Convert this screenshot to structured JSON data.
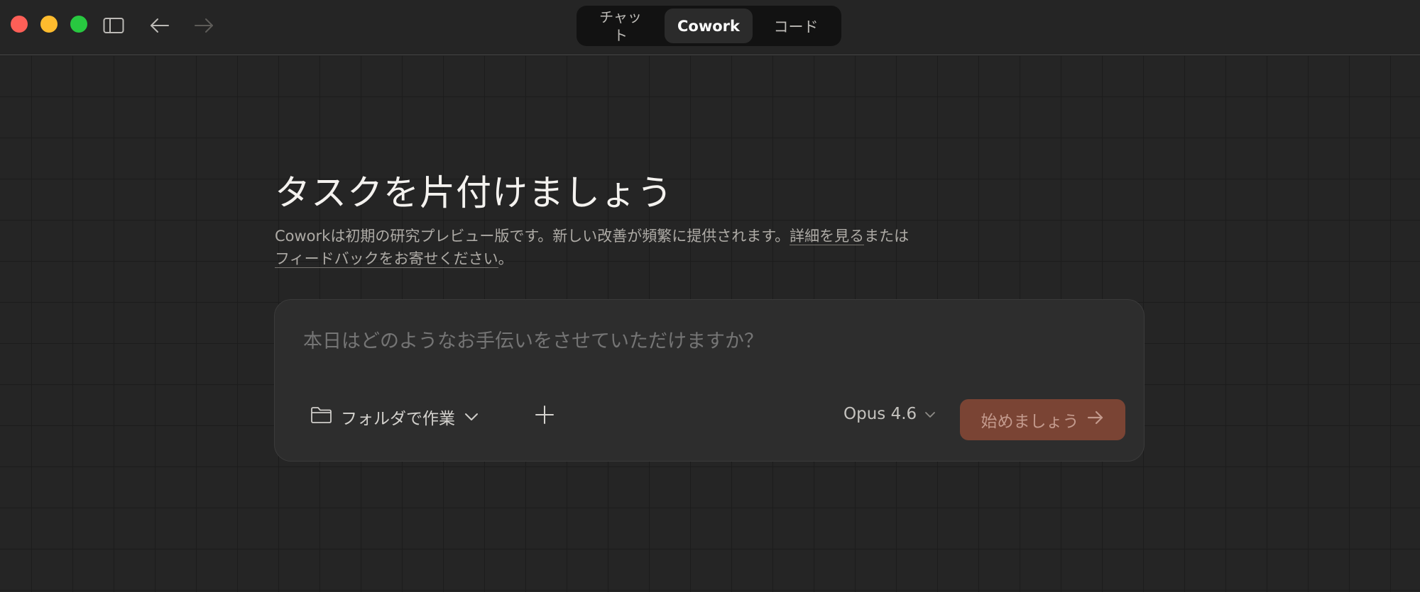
{
  "titlebar": {
    "modes": [
      {
        "label": "チャット",
        "selected": false
      },
      {
        "label": "Cowork",
        "selected": true
      },
      {
        "label": "コード",
        "selected": false
      }
    ]
  },
  "main": {
    "headline": "タスクを片付けましょう",
    "subtitle_prefix": "Coworkは初期の研究プレビュー版です。新しい改善が頻繁に提供されます。",
    "learn_more_link": "詳細を見る",
    "subtitle_middle": "または",
    "feedback_link": "フィードバックをお寄せください",
    "subtitle_suffix": "。"
  },
  "composer": {
    "placeholder": "本日はどのようなお手伝いをさせていただけますか？",
    "folder_label": "フォルダで作業",
    "model": "Opus 4.6",
    "start_label": "始めましょう"
  },
  "icons": {
    "sidebar": "sidebar-toggle-icon",
    "back": "arrow-left-icon",
    "forward": "arrow-right-icon",
    "folder": "folder-icon",
    "plus": "plus-icon",
    "chevron": "chevron-down-icon",
    "start_arrow": "arrow-right-icon"
  },
  "colors": {
    "accent_button": "#7a4434",
    "close": "#fe5f57",
    "minimize": "#febc2e",
    "zoom": "#28c840"
  }
}
